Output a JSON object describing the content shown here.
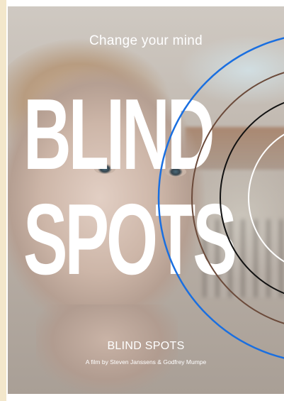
{
  "poster": {
    "tagline": "Change your mind",
    "title_line1": "BLIND",
    "title_line2": "SPOTS",
    "film_title": "BLIND SPOTS",
    "credit": "A film by Steven Janssens & Godfrey Mumpe"
  },
  "colors": {
    "ring_outer": "#1a6fe0",
    "ring_brown": "#6b4a3a",
    "ring_black": "#111111",
    "ring_white": "#ffffff",
    "text": "#ffffff",
    "side_strip": "#f3e7cb"
  }
}
